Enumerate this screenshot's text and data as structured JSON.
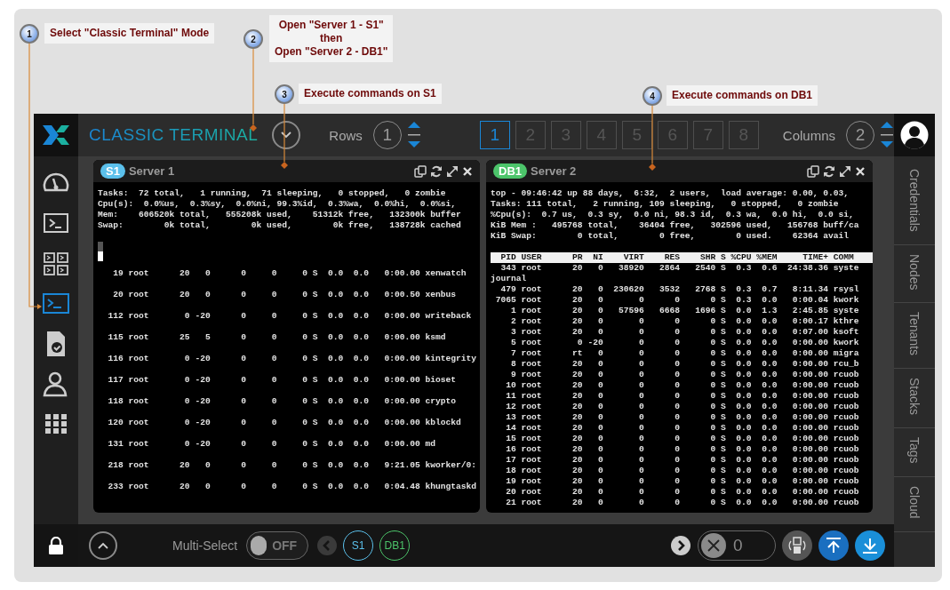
{
  "annotations": [
    {
      "number": "1",
      "text": "Select \"Classic Terminal\" Mode"
    },
    {
      "number": "2",
      "text": "Open \"Server 1 - S1\"\nthen\nOpen \"Server 2 - DB1\""
    },
    {
      "number": "3",
      "text": "Execute commands on S1"
    },
    {
      "number": "4",
      "text": "Execute commands on DB1"
    }
  ],
  "top_bar": {
    "title": "CLASSIC TERMINAL",
    "rows": {
      "label": "Rows",
      "value": "1"
    },
    "pages": [
      {
        "label": "1",
        "selected": true
      },
      {
        "label": "2",
        "selected": false
      },
      {
        "label": "3",
        "selected": false
      },
      {
        "label": "4",
        "selected": false
      },
      {
        "label": "5",
        "selected": false
      },
      {
        "label": "6",
        "selected": false
      },
      {
        "label": "7",
        "selected": false
      },
      {
        "label": "8",
        "selected": false
      }
    ],
    "columns": {
      "label": "Columns",
      "value": "2"
    }
  },
  "left_sidebar": {
    "items": [
      {
        "kind": "gauge",
        "selected": false
      },
      {
        "kind": "terminal",
        "selected": false
      },
      {
        "kind": "split",
        "selected": false
      },
      {
        "kind": "console",
        "selected": true
      },
      {
        "kind": "report",
        "selected": false
      },
      {
        "kind": "person",
        "selected": false
      },
      {
        "kind": "grid",
        "selected": false
      }
    ]
  },
  "terminals": [
    {
      "badge": "S1",
      "color": "#5bc0eb",
      "title": "Server 1",
      "double_spaced": true,
      "lines": [
        {
          "kind": "summary",
          "text": "Tasks:  72 total,   1 running,  71 sleeping,   0 stopped,   0 zombie"
        },
        {
          "kind": "summary",
          "text": "Cpu(s):  0.0%us,  0.3%sy,  0.0%ni, 99.3%id,  0.3%wa,  0.0%hi,  0.0%si,"
        },
        {
          "kind": "summary",
          "text": "Mem:    606520k total,   555208k used,    51312k free,   132300k buffer"
        },
        {
          "kind": "summary",
          "text": "Swap:        0k total,        0k used,        0k free,   138728k cached"
        },
        {
          "kind": "cursor"
        },
        {
          "kind": "row",
          "text": "   19 root      20   0      0     0     0 S  0.0  0.0   0:00.00 xenwatch"
        },
        {
          "kind": "row",
          "text": "   20 root      20   0      0     0     0 S  0.0  0.0   0:00.50 xenbus"
        },
        {
          "kind": "row",
          "text": "  112 root       0 -20      0     0     0 S  0.0  0.0   0:00.00 writeback"
        },
        {
          "kind": "row",
          "text": "  115 root      25   5      0     0     0 S  0.0  0.0   0:00.00 ksmd"
        },
        {
          "kind": "row",
          "text": "  116 root       0 -20      0     0     0 S  0.0  0.0   0:00.00 kintegrity"
        },
        {
          "kind": "row",
          "text": "  117 root       0 -20      0     0     0 S  0.0  0.0   0:00.00 bioset"
        },
        {
          "kind": "row",
          "text": "  118 root       0 -20      0     0     0 S  0.0  0.0   0:00.00 crypto"
        },
        {
          "kind": "row",
          "text": "  120 root       0 -20      0     0     0 S  0.0  0.0   0:00.00 kblockd"
        },
        {
          "kind": "row",
          "text": "  131 root       0 -20      0     0     0 S  0.0  0.0   0:00.00 md"
        },
        {
          "kind": "row",
          "text": "  218 root      20   0      0     0     0 S  0.0  0.0   9:21.05 kworker/0:"
        },
        {
          "kind": "row",
          "text": "  233 root      20   0      0     0     0 S  0.0  0.0   0:04.48 khungtaskd"
        }
      ]
    },
    {
      "badge": "DB1",
      "color": "#4cc46a",
      "title": "Server 2",
      "double_spaced": false,
      "lines": [
        {
          "kind": "summary",
          "text": "top - 09:46:42 up 88 days,  6:32,  2 users,  load average: 0.00, 0.03,"
        },
        {
          "kind": "summary",
          "text": "Tasks: 111 total,   2 running, 109 sleeping,   0 stopped,   0 zombie"
        },
        {
          "kind": "summary",
          "text": "%Cpu(s):  0.7 us,  0.3 sy,  0.0 ni, 98.3 id,  0.3 wa,  0.0 hi,  0.0 si,"
        },
        {
          "kind": "summary",
          "text": "KiB Mem :   495768 total,    36404 free,   302596 used,   156768 buff/ca"
        },
        {
          "kind": "summary",
          "text": "KiB Swap:        0 total,        0 free,        0 used.    62364 avail"
        },
        {
          "kind": "header",
          "text": "  PID USER      PR  NI    VIRT    RES    SHR S %CPU %MEM     TIME+ COMM"
        },
        {
          "kind": "row",
          "text": "  343 root      20   0   38920   2864   2540 S  0.3  0.6  24:38.36 syste"
        },
        {
          "kind": "row",
          "text": "journal"
        },
        {
          "kind": "row",
          "text": "  479 root      20   0  230620   3532   2768 S  0.3  0.7   8:11.34 rsysl"
        },
        {
          "kind": "row",
          "text": " 7065 root      20   0       0      0      0 S  0.3  0.0   0:00.04 kwork"
        },
        {
          "kind": "row",
          "text": "    1 root      20   0   57596   6668   1696 S  0.0  1.3   2:45.85 syste"
        },
        {
          "kind": "row",
          "text": "    2 root      20   0       0      0      0 S  0.0  0.0   0:00.17 kthre"
        },
        {
          "kind": "row",
          "text": "    3 root      20   0       0      0      0 S  0.0  0.0   0:07.00 ksoft"
        },
        {
          "kind": "row",
          "text": "    5 root       0 -20       0      0      0 S  0.0  0.0   0:00.00 kwork"
        },
        {
          "kind": "row",
          "text": "    7 root      rt   0       0      0      0 S  0.0  0.0   0:00.00 migra"
        },
        {
          "kind": "row",
          "text": "    8 root      20   0       0      0      0 S  0.0  0.0   0:00.00 rcu_b"
        },
        {
          "kind": "row",
          "text": "    9 root      20   0       0      0      0 S  0.0  0.0   0:00.00 rcuob"
        },
        {
          "kind": "row",
          "text": "   10 root      20   0       0      0      0 S  0.0  0.0   0:00.00 rcuob"
        },
        {
          "kind": "row",
          "text": "   11 root      20   0       0      0      0 S  0.0  0.0   0:00.00 rcuob"
        },
        {
          "kind": "row",
          "text": "   12 root      20   0       0      0      0 S  0.0  0.0   0:00.00 rcuob"
        },
        {
          "kind": "row",
          "text": "   13 root      20   0       0      0      0 S  0.0  0.0   0:00.00 rcuob"
        },
        {
          "kind": "row",
          "text": "   14 root      20   0       0      0      0 S  0.0  0.0   0:00.00 rcuob"
        },
        {
          "kind": "row",
          "text": "   15 root      20   0       0      0      0 S  0.0  0.0   0:00.00 rcuob"
        },
        {
          "kind": "row",
          "text": "   16 root      20   0       0      0      0 S  0.0  0.0   0:00.00 rcuob"
        },
        {
          "kind": "row",
          "text": "   17 root      20   0       0      0      0 S  0.0  0.0   0:00.00 rcuob"
        },
        {
          "kind": "row",
          "text": "   18 root      20   0       0      0      0 S  0.0  0.0   0:00.00 rcuob"
        },
        {
          "kind": "row",
          "text": "   19 root      20   0       0      0      0 S  0.0  0.0   0:00.00 rcuob"
        },
        {
          "kind": "row",
          "text": "   20 root      20   0       0      0      0 S  0.0  0.0   0:00.00 rcuob"
        },
        {
          "kind": "row",
          "text": "   21 root      20   0       0      0      0 S  0.0  0.0   0:00.00 rcuob"
        }
      ]
    }
  ],
  "right_sidebar": {
    "tabs": [
      {
        "label": "Credentials"
      },
      {
        "label": "Nodes"
      },
      {
        "label": "Tenants"
      },
      {
        "label": "Stacks"
      },
      {
        "label": "Tags"
      },
      {
        "label": "Cloud"
      }
    ]
  },
  "bottom_bar": {
    "multi_select": {
      "label": "Multi-Select",
      "state": "OFF",
      "on": false
    },
    "sessions": [
      {
        "label": "S1",
        "color": "#5bc0eb"
      },
      {
        "label": "DB1",
        "color": "#4cc46a"
      }
    ],
    "closed_count": "0"
  }
}
